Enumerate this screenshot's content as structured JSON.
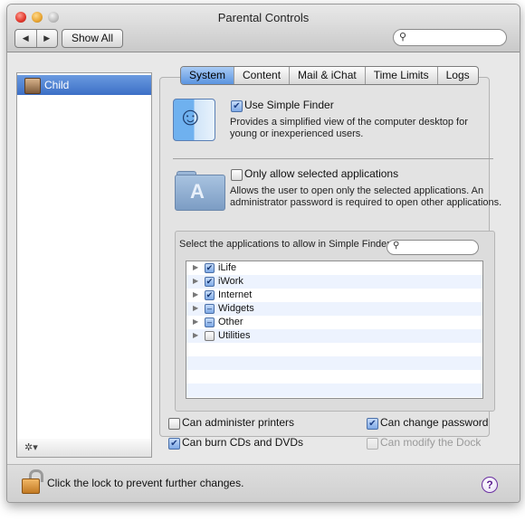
{
  "window": {
    "title": "Parental Controls"
  },
  "toolbar": {
    "back": "◀",
    "forward": "▶",
    "show_all": "Show All",
    "search_value": ""
  },
  "sidebar": {
    "items": [
      {
        "label": "Child",
        "selected": true
      }
    ],
    "gear": "✲▾"
  },
  "tabs": [
    {
      "label": "System",
      "active": true
    },
    {
      "label": "Content",
      "active": false
    },
    {
      "label": "Mail & iChat",
      "active": false
    },
    {
      "label": "Time Limits",
      "active": false
    },
    {
      "label": "Logs",
      "active": false
    }
  ],
  "simple_finder": {
    "checked": true,
    "label": "Use Simple Finder",
    "description_line1": "Provides a simplified view of the computer desktop for",
    "description_line2": "young or inexperienced users."
  },
  "only_allow": {
    "checked": false,
    "label": "Only allow selected applications",
    "description_line1": "Allows the user to open only the selected applications. An",
    "description_line2": "administrator password is required to open other applications."
  },
  "app_select": {
    "label": "Select the applications to allow in Simple Finder",
    "search_value": "",
    "items": [
      {
        "label": "iLife",
        "state": "checked"
      },
      {
        "label": "iWork",
        "state": "checked"
      },
      {
        "label": "Internet",
        "state": "checked"
      },
      {
        "label": "Widgets",
        "state": "mixed"
      },
      {
        "label": "Other",
        "state": "mixed"
      },
      {
        "label": "Utilities",
        "state": "unchecked"
      }
    ]
  },
  "options": {
    "admin_printers": {
      "label": "Can administer printers",
      "checked": false,
      "enabled": true
    },
    "change_password": {
      "label": "Can change password",
      "checked": true,
      "enabled": true
    },
    "burn_cds": {
      "label": "Can burn CDs and DVDs",
      "checked": true,
      "enabled": true
    },
    "modify_dock": {
      "label": "Can modify the Dock",
      "checked": false,
      "enabled": false
    }
  },
  "footer": {
    "lock_text": "Click the lock to prevent further changes.",
    "help": "?"
  },
  "colors": {
    "selection": "#3c6fc6",
    "tab_active": "#5a94e0",
    "window_bg": "#e8e8e8"
  }
}
